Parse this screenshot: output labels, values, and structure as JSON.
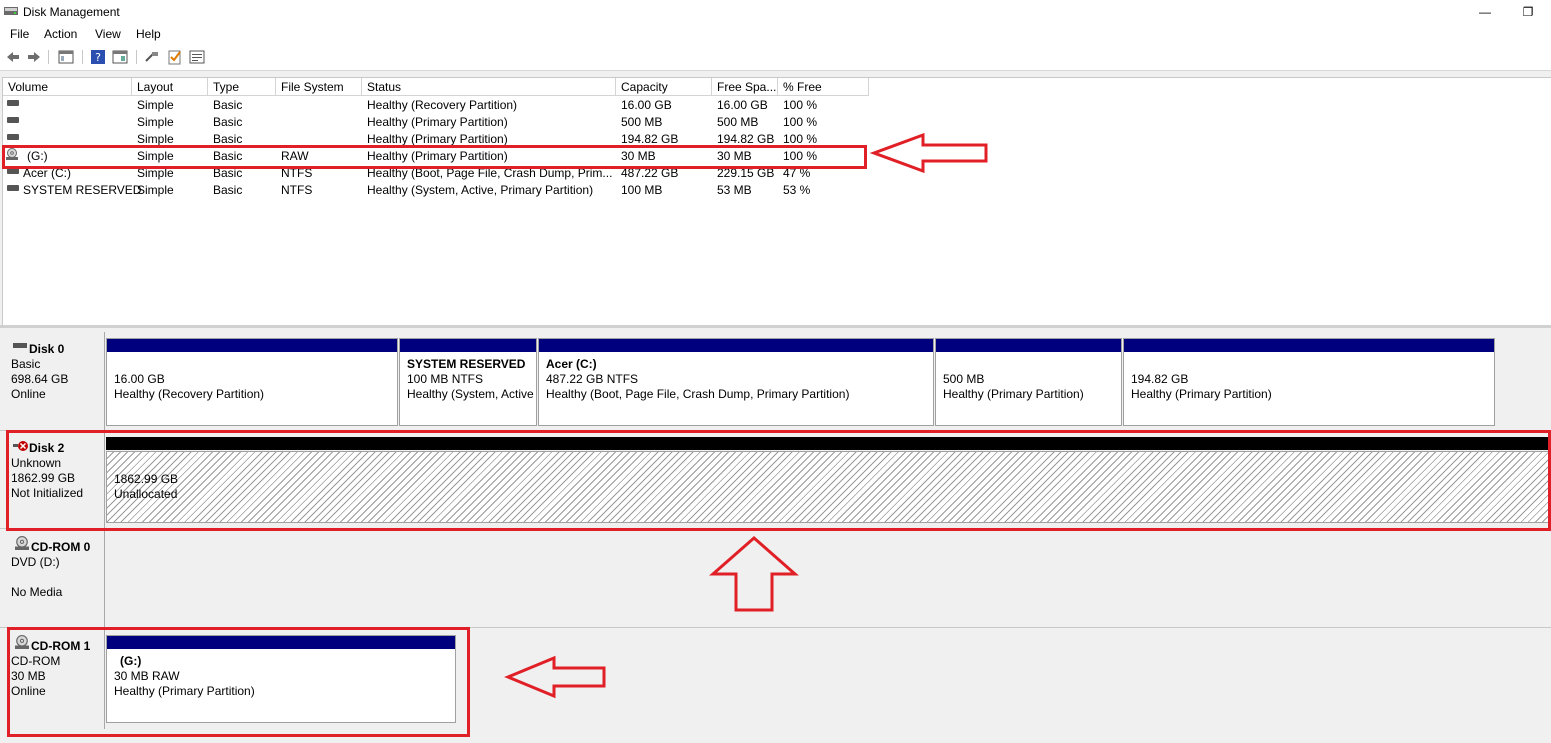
{
  "window": {
    "title": "Disk Management",
    "restore_glyph": "❐",
    "minimize_glyph": "—"
  },
  "menu": [
    "File",
    "Action",
    "View",
    "Help"
  ],
  "toolbar": {
    "icons": [
      "back-arrow-icon",
      "forward-arrow-icon",
      "list-view-icon",
      "help-icon",
      "properties-view-icon",
      "connect-icon",
      "checklist-icon",
      "settings-view-icon"
    ]
  },
  "volume_list": {
    "columns": [
      "Volume",
      "Layout",
      "Type",
      "File System",
      "Status",
      "Capacity",
      "Free Spa...",
      "% Free"
    ],
    "rows": [
      {
        "volume": "",
        "layout": "Simple",
        "type": "Basic",
        "fs": "",
        "status": "Healthy (Recovery Partition)",
        "capacity": "16.00 GB",
        "free": "16.00 GB",
        "pct": "100 %",
        "icon": "drive"
      },
      {
        "volume": "",
        "layout": "Simple",
        "type": "Basic",
        "fs": "",
        "status": "Healthy (Primary Partition)",
        "capacity": "500 MB",
        "free": "500 MB",
        "pct": "100 %",
        "icon": "drive"
      },
      {
        "volume": "",
        "layout": "Simple",
        "type": "Basic",
        "fs": "",
        "status": "Healthy (Primary Partition)",
        "capacity": "194.82 GB",
        "free": "194.82 GB",
        "pct": "100 %",
        "icon": "drive"
      },
      {
        "volume": "(G:)",
        "layout": "Simple",
        "type": "Basic",
        "fs": "RAW",
        "status": "Healthy (Primary Partition)",
        "capacity": "30 MB",
        "free": "30 MB",
        "pct": "100 %",
        "icon": "cd"
      },
      {
        "volume": "Acer (C:)",
        "layout": "Simple",
        "type": "Basic",
        "fs": "NTFS",
        "status": "Healthy (Boot, Page File, Crash Dump, Prim...",
        "capacity": "487.22 GB",
        "free": "229.15 GB",
        "pct": "47 %",
        "icon": "drive"
      },
      {
        "volume": "SYSTEM RESERVED",
        "layout": "Simple",
        "type": "Basic",
        "fs": "NTFS",
        "status": "Healthy (System, Active, Primary Partition)",
        "capacity": "100 MB",
        "free": "53 MB",
        "pct": "53 %",
        "icon": "drive"
      }
    ]
  },
  "disks": {
    "disk0": {
      "name": "Disk 0",
      "type": "Basic",
      "size": "698.64 GB",
      "state": "Online",
      "partitions": [
        {
          "title": "",
          "line2": "16.00 GB",
          "line3": "Healthy (Recovery Partition)"
        },
        {
          "title": "SYSTEM RESERVED",
          "line2": "100 MB NTFS",
          "line3": "Healthy (System, Active"
        },
        {
          "title": "Acer  (C:)",
          "line2": "487.22 GB NTFS",
          "line3": "Healthy (Boot, Page File, Crash Dump, Primary Partition)"
        },
        {
          "title": "",
          "line2": "500 MB",
          "line3": "Healthy (Primary Partition)"
        },
        {
          "title": "",
          "line2": "194.82 GB",
          "line3": "Healthy (Primary Partition)"
        }
      ]
    },
    "disk2": {
      "name": "Disk 2",
      "type": "Unknown",
      "size": "1862.99 GB",
      "state": "Not Initialized",
      "unallocated": {
        "size": "1862.99 GB",
        "label": "Unallocated"
      }
    },
    "cdrom0": {
      "name": "CD-ROM 0",
      "type": "DVD (D:)",
      "size": "",
      "state": "No Media"
    },
    "cdrom1": {
      "name": "CD-ROM 1",
      "type": "CD-ROM",
      "size": "30 MB",
      "state": "Online",
      "partition": {
        "title": "(G:)",
        "line2": "30 MB RAW",
        "line3": "Healthy (Primary Partition)"
      }
    }
  },
  "colors": {
    "partition_bar": "#00007f",
    "not_initialized_bar": "#000000",
    "highlight": "#e02026"
  }
}
